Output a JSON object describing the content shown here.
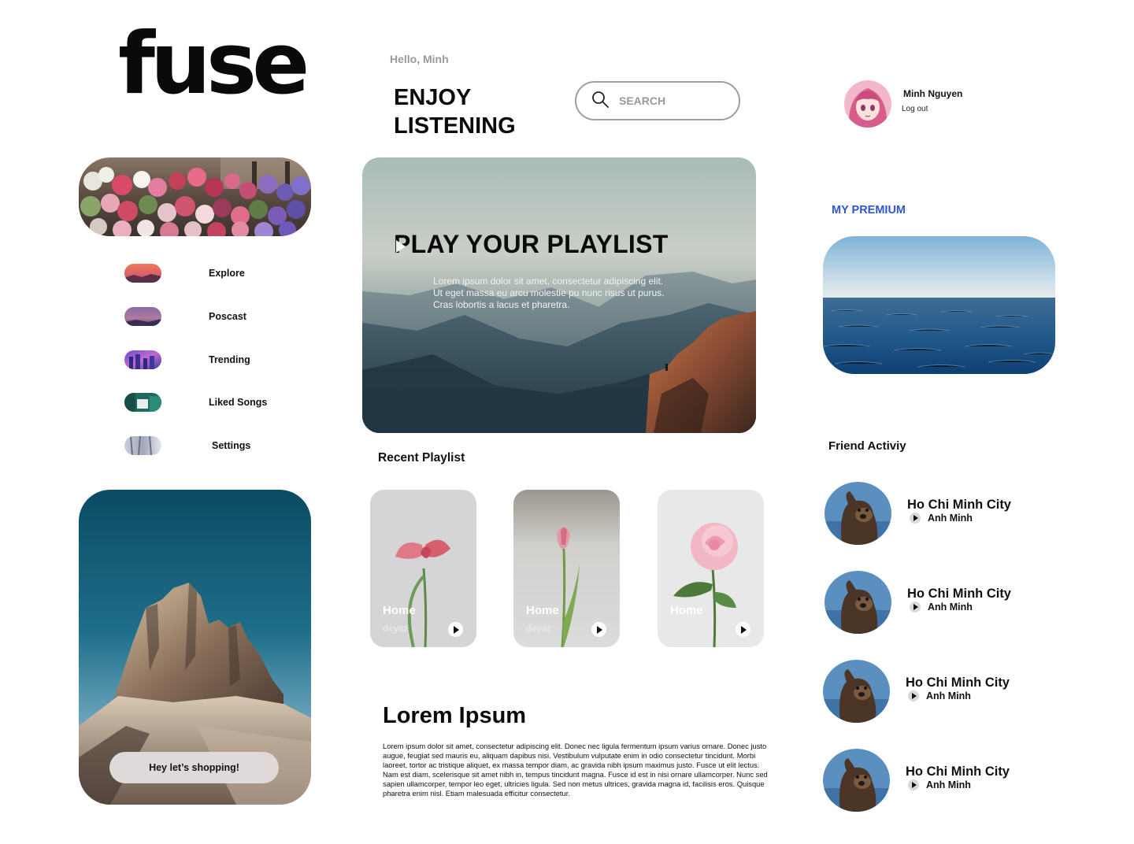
{
  "brand": {
    "logo_text": "fuse"
  },
  "greeting": "Hello, Minh",
  "headline": "ENJOY LISTENING",
  "search": {
    "placeholder": "SEARCH"
  },
  "user": {
    "name": "Minh Nguyen",
    "logout_label": "Log out"
  },
  "nav": {
    "items": [
      {
        "label": "Explore",
        "icon": "sunset-thumbnail"
      },
      {
        "label": "Poscast",
        "icon": "dusk-thumbnail"
      },
      {
        "label": "Trending",
        "icon": "city-thumbnail"
      },
      {
        "label": "Liked Songs",
        "icon": "teal-building-thumbnail"
      },
      {
        "label": "Settings",
        "icon": "snow-thumbnail"
      }
    ]
  },
  "hero": {
    "title": "PLAY YOUR PLAYLIST",
    "description": "Lorem ipsum dolor sit amet, consectetur adipiscing elit. Ut eget massa eu arcu molestie pu nunc risus ut purus. Cras lobortis a lacus et pharetra."
  },
  "recent": {
    "title": "Recent Playlist",
    "cards": [
      {
        "title": "Home",
        "subtitle": "deyaz"
      },
      {
        "title": "Home",
        "subtitle": "deyaz"
      },
      {
        "title": "Home",
        "subtitle": "deyaz"
      }
    ]
  },
  "article": {
    "title": "Lorem Ipsum",
    "body": "Lorem ipsum dolor sit amet, consectetur adipiscing elit. Donec nec ligula fermentum ipsum varius ornare. Donec justo augue, feugiat sed mauris eu, aliquam dapibus nisi. Vestibulum vulputate enim in odio consectetur tincidunt. Morbi laoreet, tortor ac tristique aliquet, ex massa tempor diam, ac gravida nibh ipsum maximus justo. Fusce ut elit lectus. Nam est diam, scelerisque sit amet nibh in, tempus tincidunt magna. Fusce id est in nisi ornare ullamcorper. Nunc sed sapien ullamcorper, tempor leo eget, ultricies ligula. Sed non metus ultrices, gravida magna id, facilisis eros. Quisque pharetra enim nisl. Etiam malesuada efficitur consectetur."
  },
  "premium": {
    "title": "MY PREMIUM"
  },
  "promo": {
    "button_label": "Hey let’s shopping!"
  },
  "friends": {
    "title": "Friend Activiy",
    "items": [
      {
        "city": "Ho Chi Minh City",
        "artist": "Anh Minh"
      },
      {
        "city": "Ho Chi Minh City",
        "artist": "Anh Minh"
      },
      {
        "city": "Ho Chi Minh City",
        "artist": "Anh Minh"
      },
      {
        "city": "Ho Chi Minh City",
        "artist": "Anh Minh"
      }
    ]
  },
  "colors": {
    "accent": "#3156d6",
    "button_bg": "#e0d9d9",
    "muted_text": "#9a9a9a"
  }
}
